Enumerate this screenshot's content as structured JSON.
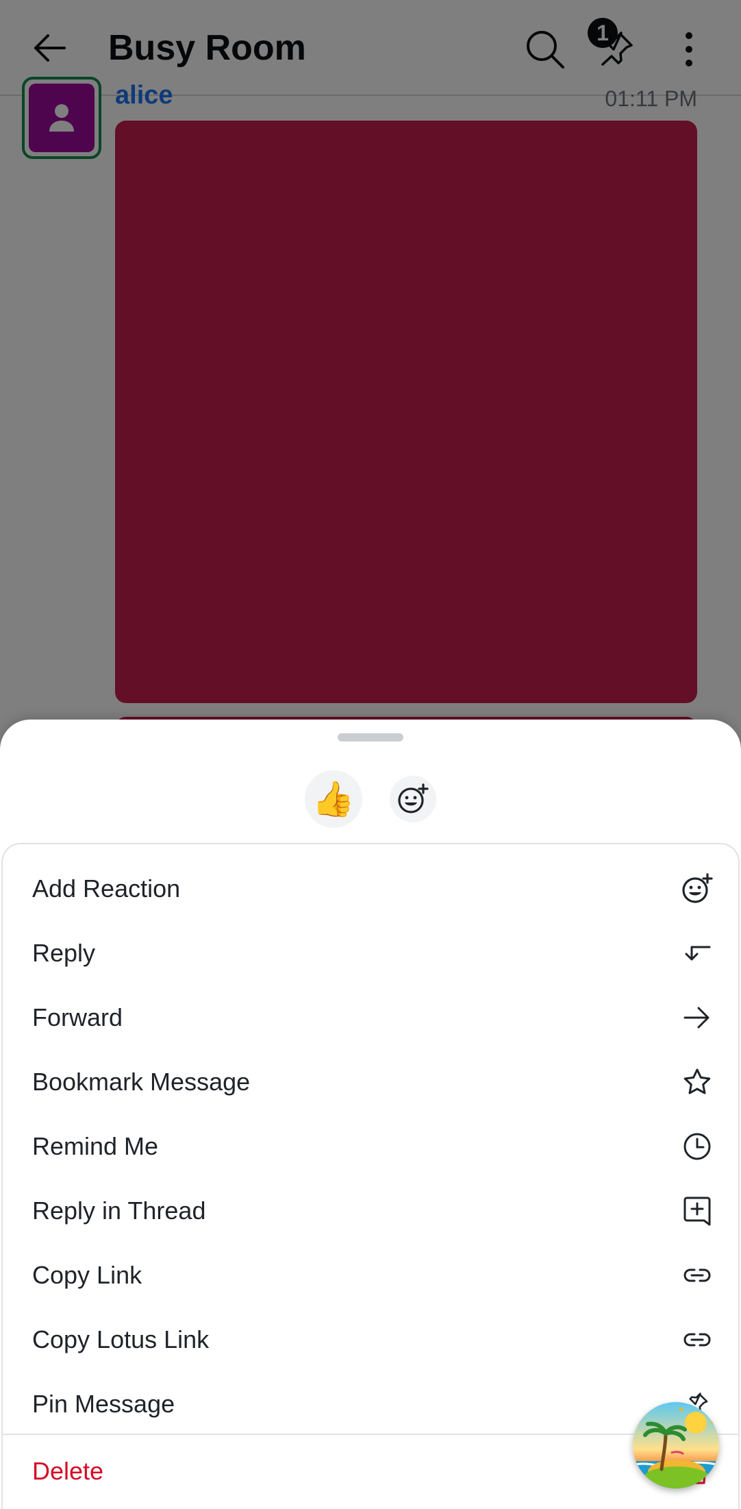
{
  "header": {
    "title": "Busy Room",
    "pinned_count": "1"
  },
  "message": {
    "author": "alice",
    "time": "01:11 PM",
    "image_color": "#c71e4f"
  },
  "quick_reactions": {
    "emoji": "👍"
  },
  "actions": [
    {
      "label": "Add Reaction",
      "icon": "add-reaction-icon"
    },
    {
      "label": "Reply",
      "icon": "reply-icon"
    },
    {
      "label": "Forward",
      "icon": "forward-arrow-icon"
    },
    {
      "label": "Bookmark Message",
      "icon": "star-icon"
    },
    {
      "label": "Remind Me",
      "icon": "clock-icon"
    },
    {
      "label": "Reply in Thread",
      "icon": "thread-plus-icon"
    },
    {
      "label": "Copy Link",
      "icon": "link-icon"
    },
    {
      "label": "Copy Lotus Link",
      "icon": "link-icon"
    },
    {
      "label": "Pin Message",
      "icon": "pin-icon"
    }
  ],
  "delete": {
    "label": "Delete",
    "color": "#d40c26",
    "icon": "trash-icon"
  },
  "colors": {
    "accent": "#1d74f5",
    "avatar_bg": "#9c0b9c",
    "avatar_border": "#158a4d"
  }
}
